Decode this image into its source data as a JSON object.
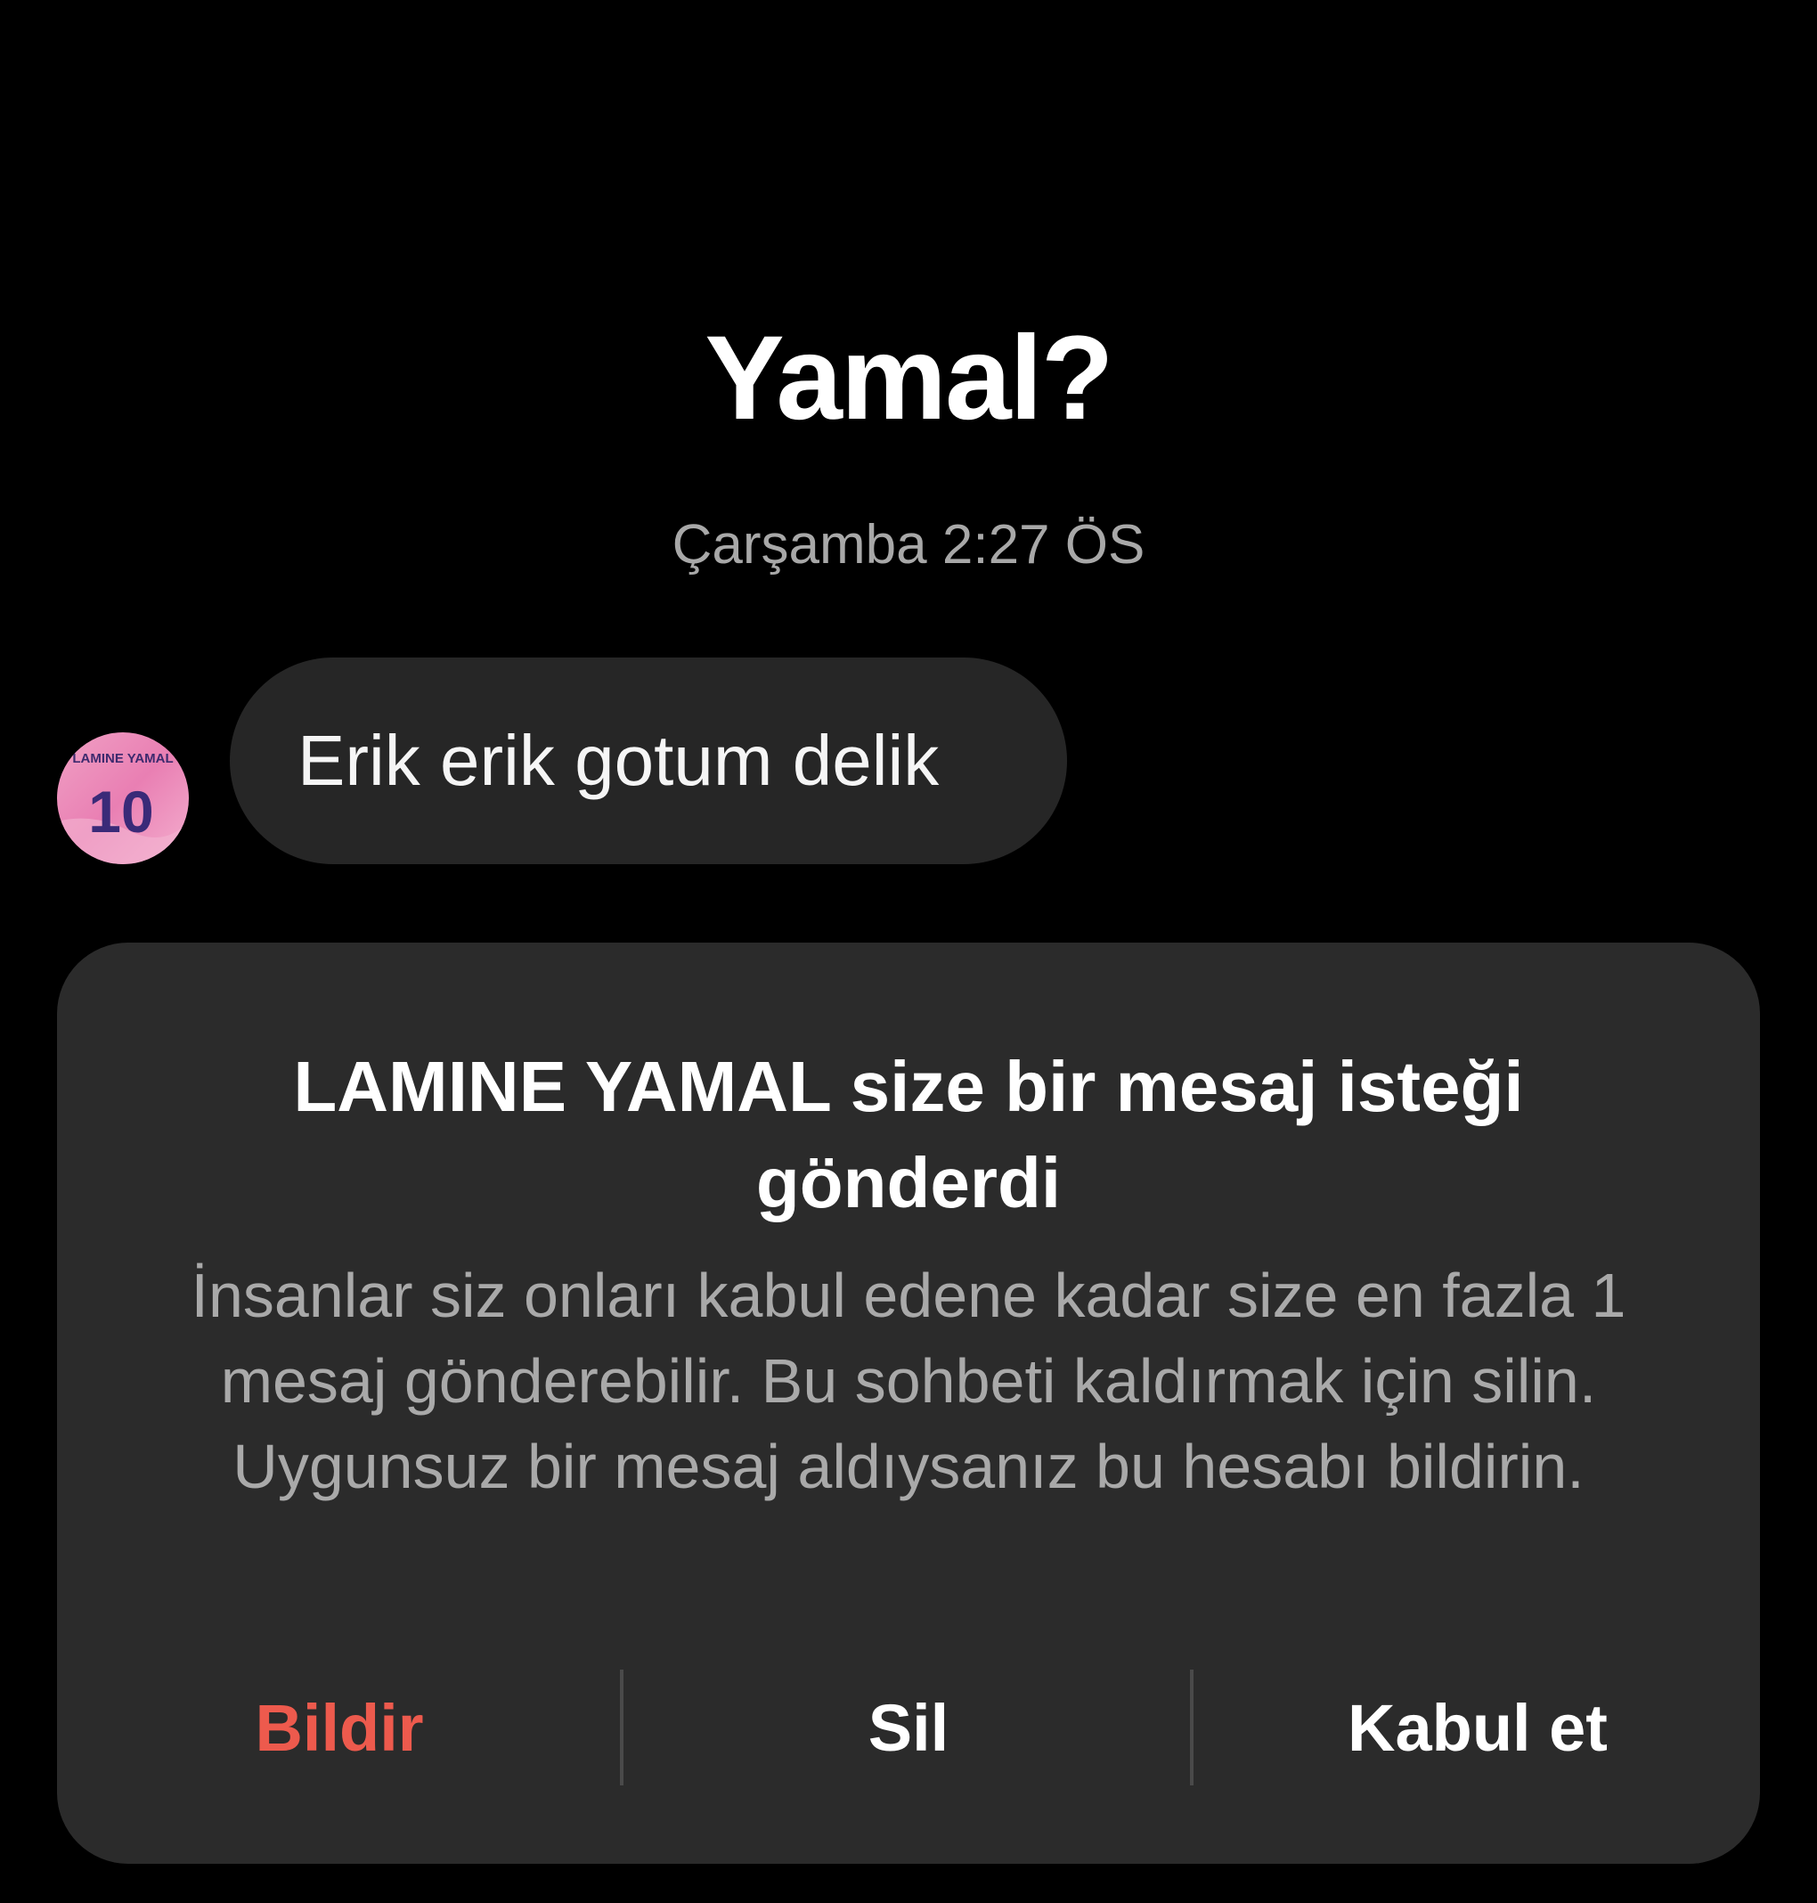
{
  "thread": {
    "big_message": "Yamal?",
    "timestamp": "Çarşamba 2:27 ÖS"
  },
  "message": {
    "avatar_label": "LAMINE YAMAL",
    "avatar_number": "10",
    "text": "Erik erik gotum delik"
  },
  "request": {
    "title": "LAMINE  YAMAL size bir mesaj isteği gönderdi",
    "body": "İnsanlar siz onları kabul edene kadar size en fazla 1 mesaj gönderebilir. Bu sohbeti kaldırmak için silin. Uygunsuz bir mesaj aldıysanız bu hesabı bildirin.",
    "actions": {
      "report": "Bildir",
      "delete": "Sil",
      "accept": "Kabul et"
    }
  },
  "colors": {
    "background": "#000000",
    "bubble": "#262626",
    "card": "#2b2b2b",
    "report": "#ed5a4d",
    "muted_text": "#a9a9a9"
  }
}
